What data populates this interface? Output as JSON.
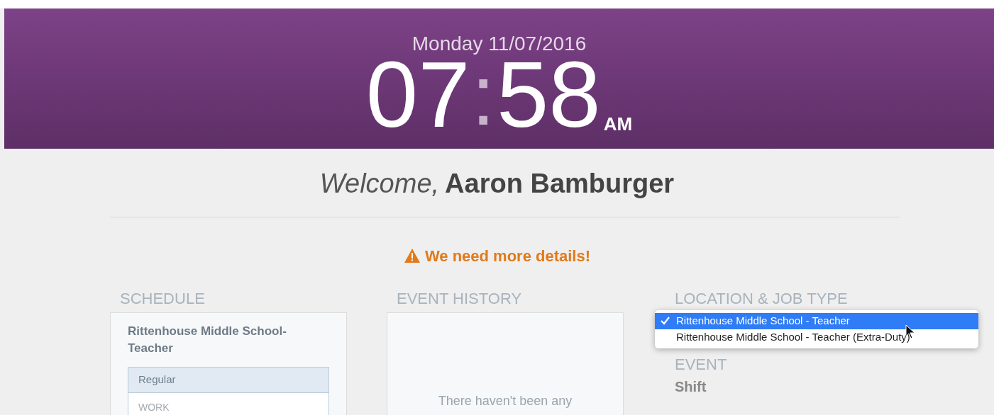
{
  "header": {
    "date": "Monday 11/07/2016",
    "clock": {
      "hours": "07",
      "separator": ":",
      "minutes": "58",
      "meridiem": "AM"
    }
  },
  "welcome": {
    "greeting": "Welcome,",
    "name": "Aaron Bamburger"
  },
  "alert": {
    "text": "We need more details!"
  },
  "schedule": {
    "title": "SCHEDULE",
    "job": "Rittenhouse Middle School-Teacher",
    "shift_type": "Regular",
    "label": "WORK"
  },
  "event_history": {
    "title": "EVENT HISTORY",
    "empty_message": "There haven't been any"
  },
  "location": {
    "title": "LOCATION & JOB TYPE",
    "options": [
      {
        "label": "Rittenhouse Middle School - Teacher",
        "selected": true
      },
      {
        "label": "Rittenhouse Middle School - Teacher (Extra-Duty)",
        "selected": false
      }
    ],
    "event_label": "EVENT",
    "event_value": "Shift"
  }
}
